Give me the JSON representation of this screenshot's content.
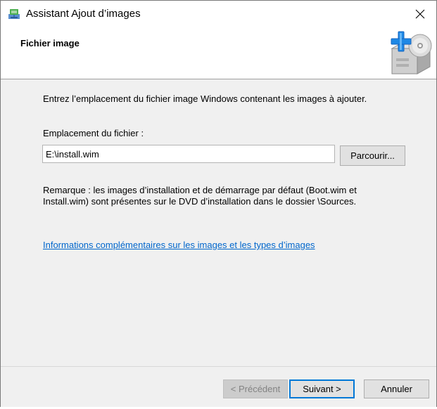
{
  "window": {
    "title": "Assistant Ajout d’images",
    "close_glyph": "✕"
  },
  "header": {
    "title": "Fichier image",
    "icon": "add-image-cd-box-icon"
  },
  "content": {
    "intro": "Entrez l’emplacement du fichier image Windows contenant les images à ajouter.",
    "location_label": "Emplacement du fichier :",
    "path_value": "E:\\install.wim",
    "browse_label": "Parcourir...",
    "note_line1": "Remarque : les images d’installation et de démarrage par défaut (Boot.wim et",
    "note_line2": "Install.wim) sont présentes sur le DVD d’installation dans le dossier \\Sources.",
    "link_text": "Informations complémentaires sur les images et les types d’images"
  },
  "footer": {
    "prev_label": "< Précédent",
    "next_label": "Suivant >",
    "cancel_label": "Annuler"
  },
  "colors": {
    "link": "#0066cc",
    "accent_border": "#0078d7",
    "dialog_bg": "#f0f0f0"
  }
}
